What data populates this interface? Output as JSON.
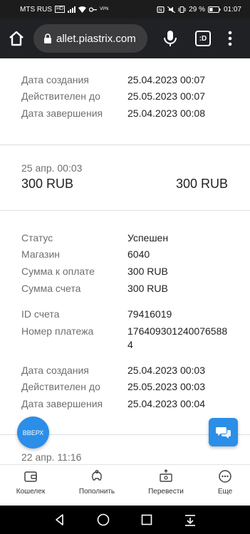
{
  "status_bar": {
    "carrier": "MTS RUS",
    "carrier_badge": "HD",
    "vpn": "VPN",
    "battery": "29 %",
    "time": "01:07"
  },
  "browser": {
    "url": "allet.piastrix.com",
    "tab_label": ":D"
  },
  "transactions": [
    {
      "date_created_label": "Дата создания",
      "date_created": "25.04.2023 00:07",
      "valid_until_label": "Действителен до",
      "valid_until": "25.05.2023 00:07",
      "date_completed_label": "Дата завершения",
      "date_completed": "25.04.2023 00:08"
    },
    {
      "header_date": "25 апр. 00:03",
      "amount_left": "300 RUB",
      "amount_right": "300 RUB",
      "status_label": "Статус",
      "status": "Успешен",
      "shop_label": "Магазин",
      "shop": "6040",
      "pay_sum_label": "Сумма к оплате",
      "pay_sum": "300 RUB",
      "invoice_sum_label": "Сумма счета",
      "invoice_sum": "300 RUB",
      "invoice_id_label": "ID счета",
      "invoice_id": "79416019",
      "payment_no_label": "Номер платежа",
      "payment_no_line1": "176409301240076588",
      "payment_no_line2": "4",
      "date_created_label": "Дата создания",
      "date_created": "25.04.2023 00:03",
      "valid_until_label": "Действителен до",
      "valid_until": "25.05.2023 00:03",
      "date_completed_label": "Дата завершения",
      "date_completed": "25.04.2023 00:04"
    },
    {
      "header_date": "22 апр. 11:16"
    }
  ],
  "floating": {
    "up_label": "ВВЕРХ",
    "chat_icon": "chat-bubbles-icon"
  },
  "bottom_nav": [
    {
      "label": "Кошелек",
      "icon": "wallet-icon"
    },
    {
      "label": "Пополнить",
      "icon": "piggy-bank-icon"
    },
    {
      "label": "Перевести",
      "icon": "transfer-icon"
    },
    {
      "label": "Еще",
      "icon": "more-icon"
    }
  ],
  "colors": {
    "accent": "#2b8ee8",
    "label": "#6f6f6f",
    "text": "#222222"
  }
}
